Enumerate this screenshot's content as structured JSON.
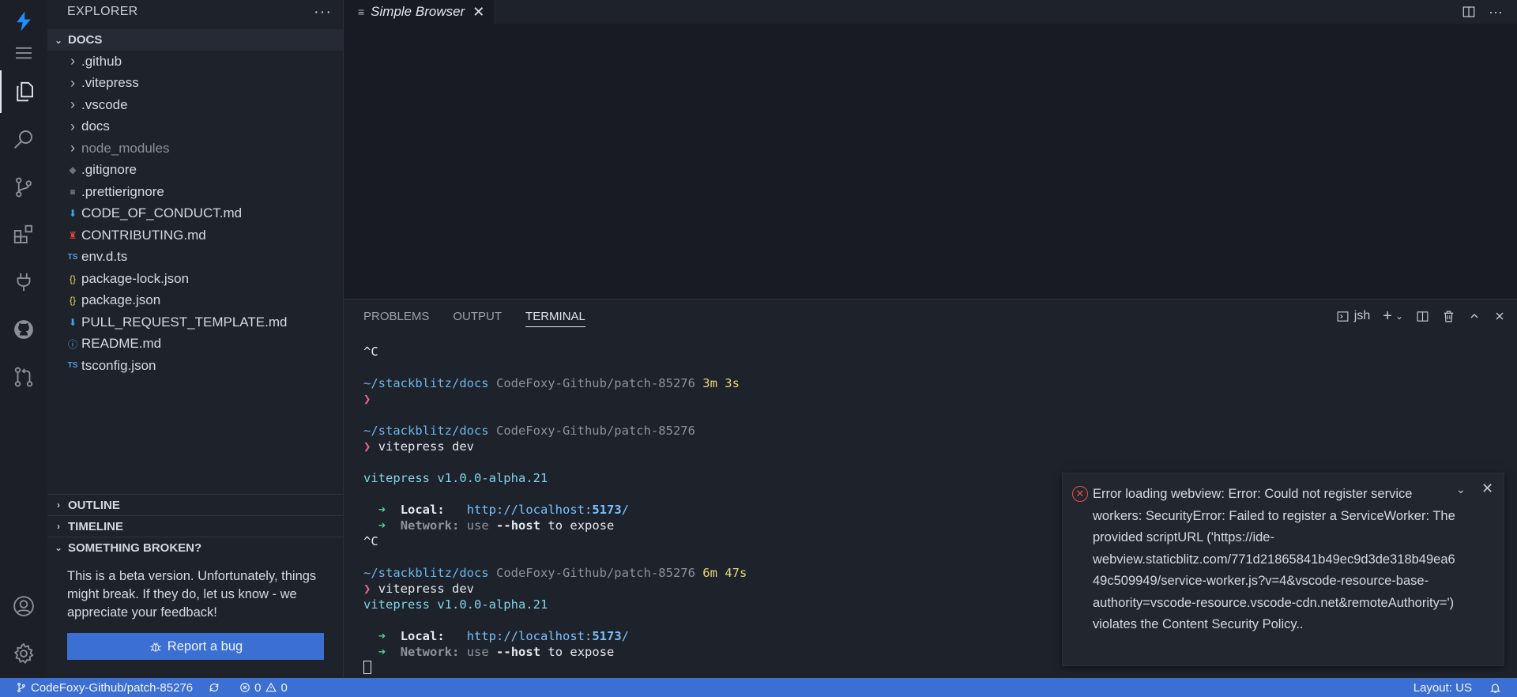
{
  "colors": {
    "accent": "#3b6fd1",
    "error": "#f14c4c",
    "activity_bar": "#1c1f26",
    "sidebar": "#1e222b",
    "editor": "#181b22"
  },
  "activity": {
    "icons": [
      "stackblitz-logo-icon",
      "menu-icon",
      "explorer-icon",
      "search-icon",
      "source-control-icon",
      "extensions-icon",
      "plug-icon",
      "github-icon",
      "pull-request-icon",
      "account-icon",
      "settings-gear-icon"
    ]
  },
  "sidebar": {
    "header": "EXPLORER",
    "more": "···",
    "root_folder": "DOCS",
    "items": [
      {
        "label": ".github",
        "type": "folder"
      },
      {
        "label": ".vitepress",
        "type": "folder"
      },
      {
        "label": ".vscode",
        "type": "folder"
      },
      {
        "label": "docs",
        "type": "folder"
      },
      {
        "label": "node_modules",
        "type": "folder",
        "dim": true
      },
      {
        "label": ".gitignore",
        "type": "file",
        "icon": "◆"
      },
      {
        "label": ".prettierignore",
        "type": "file",
        "icon": "≡"
      },
      {
        "label": "CODE_OF_CONDUCT.md",
        "type": "file",
        "icon": "⬇"
      },
      {
        "label": "CONTRIBUTING.md",
        "type": "file",
        "icon": "♜"
      },
      {
        "label": "env.d.ts",
        "type": "file",
        "icon": "TS"
      },
      {
        "label": "package-lock.json",
        "type": "file",
        "icon": "{}"
      },
      {
        "label": "package.json",
        "type": "file",
        "icon": "{}"
      },
      {
        "label": "PULL_REQUEST_TEMPLATE.md",
        "type": "file",
        "icon": "⬇"
      },
      {
        "label": "README.md",
        "type": "file",
        "icon": "ⓘ"
      },
      {
        "label": "tsconfig.json",
        "type": "file",
        "icon": "TS"
      }
    ],
    "outline": "OUTLINE",
    "timeline": "TIMELINE",
    "broken": "SOMETHING BROKEN?",
    "broken_text": "This is a beta version. Unfortunately, things might break. If they do, let us know - we appreciate your feedback!",
    "report_button": "Report a bug"
  },
  "editor": {
    "tab_label": "Simple Browser",
    "tab_icon": "≡",
    "tab_close": "✕"
  },
  "panel": {
    "tabs": [
      "PROBLEMS",
      "OUTPUT",
      "TERMINAL"
    ],
    "active_tab": "TERMINAL",
    "shell": "jsh",
    "terminal": {
      "ctrl_c": "^C",
      "path": "~/stackblitz/docs",
      "branch": "CodeFoxy-Github/patch-85276",
      "duration_1": "3m 3s",
      "duration_2": "6m 47s",
      "prompt": "❯",
      "command": "vitepress dev",
      "version": "vitepress v1.0.0-alpha.21",
      "arrow": "➜",
      "local_label": "Local:",
      "local_url_a": "http://localhost:",
      "local_port": "5173",
      "local_url_b": "/",
      "network_label": "Network:",
      "network_use": "use",
      "network_flag": "--host",
      "network_rest": "to expose"
    }
  },
  "notification": {
    "message": "Error loading webview: Error: Could not register service workers: SecurityError: Failed to register a ServiceWorker: The provided scriptURL ('https://ide-webview.staticblitz.com/771d21865841b49ec9d3de318b49ea649c509949/service-worker.js?v=4&vscode-resource-base-authority=vscode-resource.vscode-cdn.net&remoteAuthority=') violates the Content Security Policy.."
  },
  "statusbar": {
    "branch": "CodeFoxy-Github/patch-85276",
    "errors": "0",
    "warnings": "0",
    "layout": "Layout: US",
    "bell": "🔔"
  }
}
